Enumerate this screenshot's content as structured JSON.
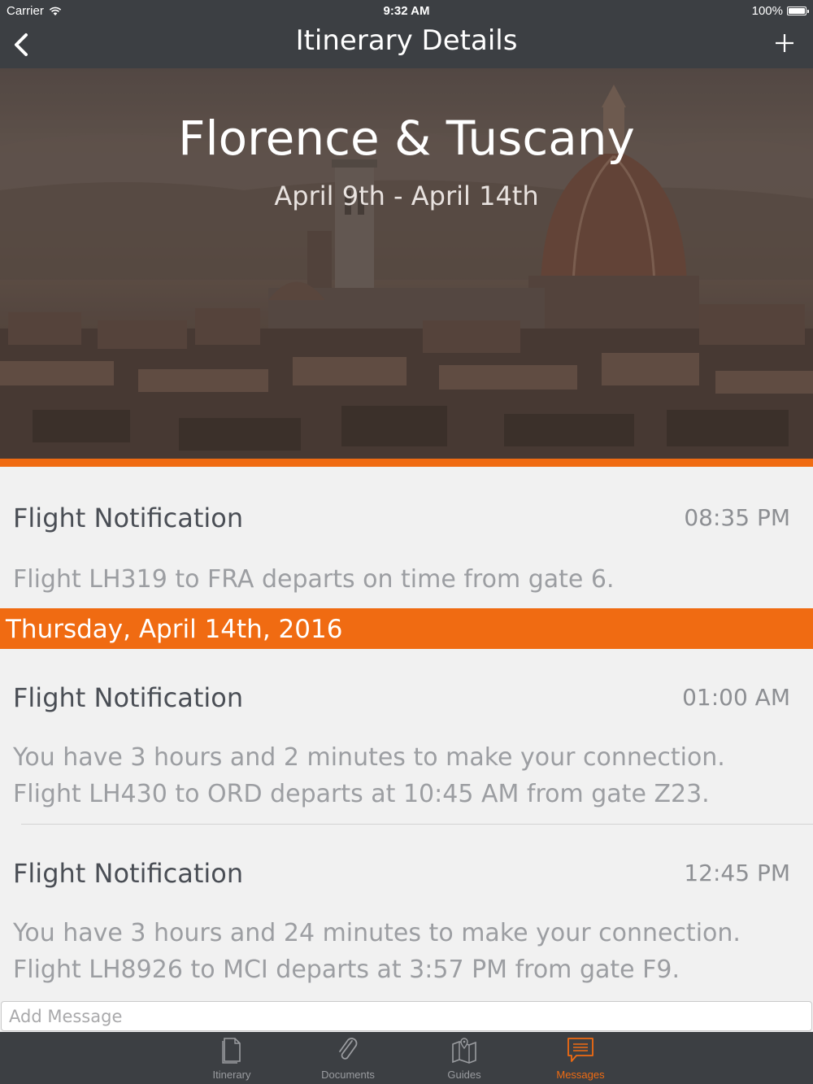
{
  "status_bar": {
    "carrier": "Carrier",
    "time": "9:32 AM",
    "battery": "100%"
  },
  "nav": {
    "title": "Itinerary Details",
    "back_icon": "chevron-left-icon",
    "add_icon": "plus-icon"
  },
  "trip": {
    "title": "Florence & Tuscany",
    "dates": "April 9th - April 14th"
  },
  "messages": {
    "groups": [
      {
        "items": [
          {
            "title": "Flight Notification",
            "time": "08:35 PM",
            "body": "Flight LH319 to FRA departs on time from gate 6."
          }
        ]
      },
      {
        "day": "Thursday, April 14th, 2016",
        "items": [
          {
            "title": "Flight Notification",
            "time": "01:00 AM",
            "body": "You have 3 hours and 2 minutes to make your connection.\nFlight LH430 to ORD departs at 10:45 AM from gate Z23."
          },
          {
            "title": "Flight Notification",
            "time": "12:45 PM",
            "body": "You have 3 hours and 24 minutes to make your connection.\nFlight LH8926 to MCI departs at 3:57 PM from gate F9."
          }
        ]
      }
    ]
  },
  "compose": {
    "placeholder": "Add Message"
  },
  "tabs": [
    {
      "label": "Itinerary",
      "icon": "document-icon",
      "active": false
    },
    {
      "label": "Documents",
      "icon": "paperclip-icon",
      "active": false
    },
    {
      "label": "Guides",
      "icon": "map-icon",
      "active": false
    },
    {
      "label": "Messages",
      "icon": "message-icon",
      "active": true
    }
  ],
  "colors": {
    "accent": "#f06b12",
    "bar": "#3c3f43",
    "background": "#f1f1f1"
  }
}
